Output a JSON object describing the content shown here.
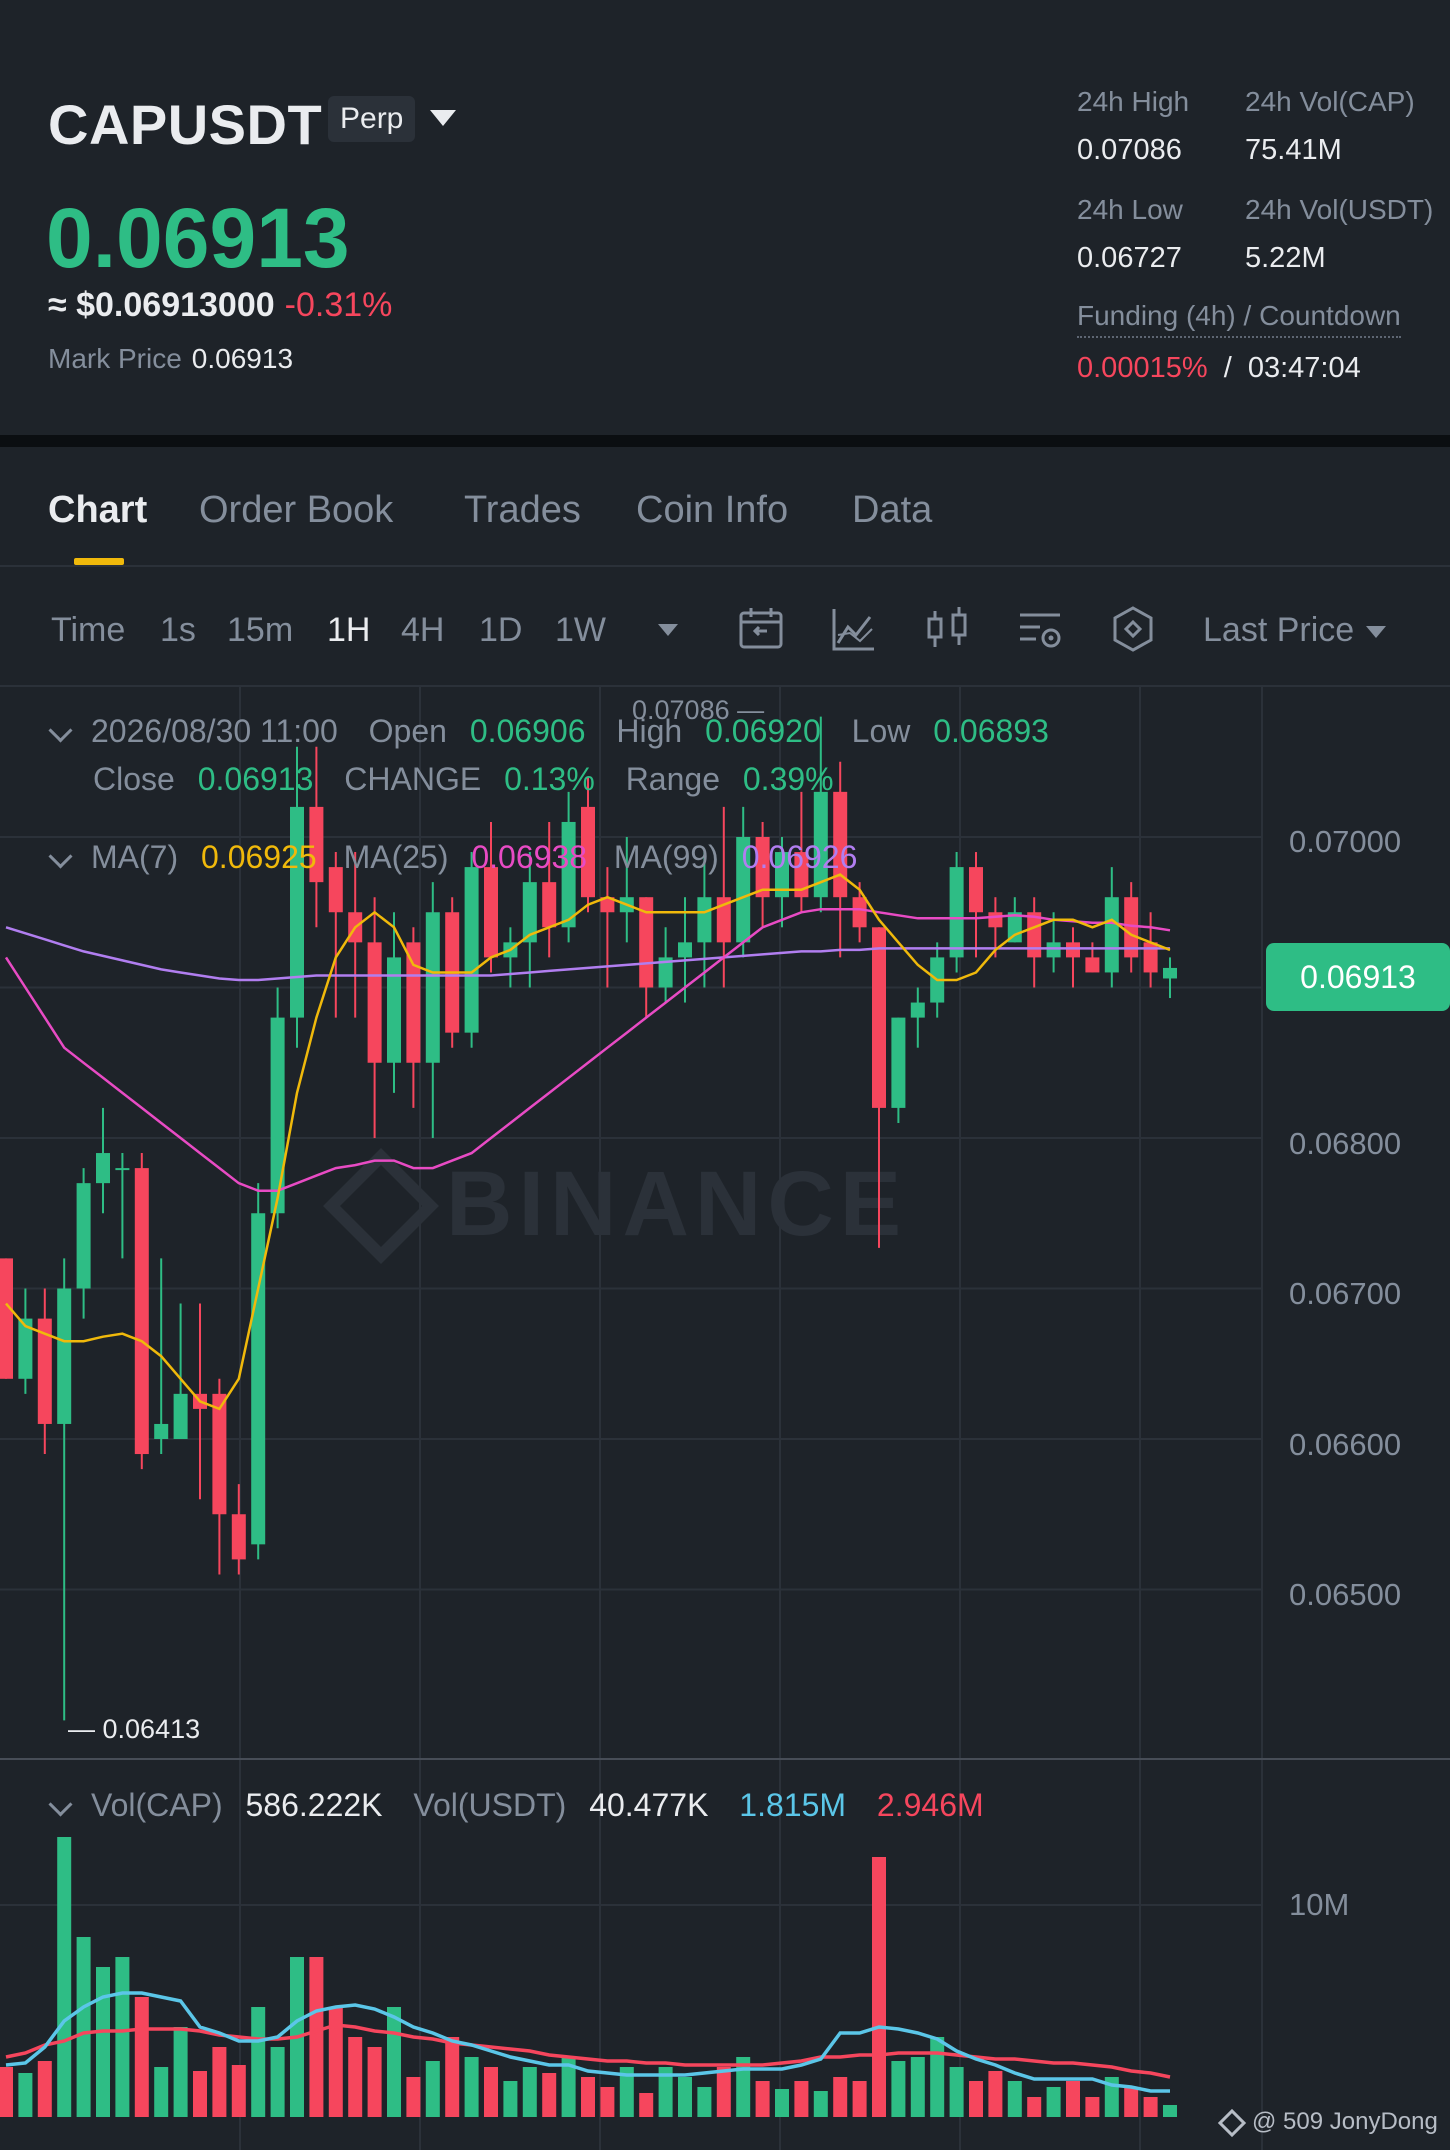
{
  "header": {
    "symbol": "CAPUSDT",
    "badge": "Perp",
    "last_price": "0.06913",
    "usd_price": "≈ $0.06913000",
    "change_pct": "-0.31%",
    "mark_price_label": "Mark Price",
    "mark_price": "0.06913",
    "stats": {
      "high_label": "24h High",
      "high": "0.07086",
      "vol_cap_label": "24h Vol(CAP)",
      "vol_cap": "75.41M",
      "low_label": "24h Low",
      "low": "0.06727",
      "vol_usdt_label": "24h Vol(USDT)",
      "vol_usdt": "5.22M",
      "funding_label": "Funding (4h) / Countdown",
      "funding_rate": "0.00015%",
      "funding_sep": "/",
      "countdown": "03:47:04"
    }
  },
  "tabs": [
    "Chart",
    "Order Book",
    "Trades",
    "Coin Info",
    "Data"
  ],
  "toolbar": {
    "timeframes": [
      "Time",
      "1s",
      "15m",
      "1H",
      "4H",
      "1D",
      "1W"
    ],
    "active_timeframe": "1H",
    "price_type": "Last Price"
  },
  "info": {
    "datetime": "2026/08/30 11:00",
    "open_label": "Open",
    "open": "0.06906",
    "high_label": "High",
    "high": "0.06920",
    "low_label": "Low",
    "low": "0.06893",
    "close_label": "Close",
    "close": "0.06913",
    "change_label": "CHANGE",
    "change": "0.13%",
    "range_label": "Range",
    "range": "0.39%",
    "ma7_label": "MA(7)",
    "ma7": "0.06925",
    "ma25_label": "MA(25)",
    "ma25": "0.06938",
    "ma99_label": "MA(99)",
    "ma99": "0.06926",
    "vol_cap_label": "Vol(CAP)",
    "vol_cap": "586.222K",
    "vol_usdt_label": "Vol(USDT)",
    "vol_usdt": "40.477K",
    "vol_ma1": "1.815M",
    "vol_ma2": "2.946M"
  },
  "axis": {
    "price_ticks": [
      "0.07000",
      "0.06800",
      "0.06700",
      "0.06600",
      "0.06500"
    ],
    "current_price_tag": "0.06913",
    "high_marker": "0.07086",
    "low_marker": "0.06413",
    "volume_tick": "10M"
  },
  "watermark": "BINANCE",
  "credit": "@ 509 JonyDong",
  "colors": {
    "up": "#2ebd85",
    "down": "#f6465d",
    "ma7": "#f0b90b",
    "ma25": "#e84bc4",
    "ma99": "#b17ef0",
    "vol_ma1": "#5bc6e8",
    "vol_ma2": "#f6465d"
  },
  "chart_data": {
    "type": "candlestick",
    "price_range": [
      0.064,
      0.071
    ],
    "candles": [
      {
        "o": 0.0672,
        "h": 0.0672,
        "l": 0.0664,
        "c": 0.0664
      },
      {
        "o": 0.0664,
        "h": 0.067,
        "l": 0.0663,
        "c": 0.0668
      },
      {
        "o": 0.0668,
        "h": 0.067,
        "l": 0.0659,
        "c": 0.0661
      },
      {
        "o": 0.0661,
        "h": 0.0672,
        "l": 0.06413,
        "c": 0.067
      },
      {
        "o": 0.067,
        "h": 0.0678,
        "l": 0.0668,
        "c": 0.0677
      },
      {
        "o": 0.0677,
        "h": 0.0682,
        "l": 0.0675,
        "c": 0.0679
      },
      {
        "o": 0.0678,
        "h": 0.0679,
        "l": 0.0672,
        "c": 0.0678
      },
      {
        "o": 0.0678,
        "h": 0.0679,
        "l": 0.0658,
        "c": 0.0659
      },
      {
        "o": 0.066,
        "h": 0.0672,
        "l": 0.0659,
        "c": 0.0661
      },
      {
        "o": 0.066,
        "h": 0.0669,
        "l": 0.066,
        "c": 0.0663
      },
      {
        "o": 0.0663,
        "h": 0.0669,
        "l": 0.0656,
        "c": 0.0662
      },
      {
        "o": 0.0663,
        "h": 0.0664,
        "l": 0.0651,
        "c": 0.0655
      },
      {
        "o": 0.0655,
        "h": 0.0657,
        "l": 0.0651,
        "c": 0.0652
      },
      {
        "o": 0.0653,
        "h": 0.0677,
        "l": 0.0652,
        "c": 0.0675
      },
      {
        "o": 0.0675,
        "h": 0.069,
        "l": 0.0674,
        "c": 0.0688
      },
      {
        "o": 0.0688,
        "h": 0.0706,
        "l": 0.0686,
        "c": 0.0702
      },
      {
        "o": 0.0702,
        "h": 0.0706,
        "l": 0.0694,
        "c": 0.0697
      },
      {
        "o": 0.0698,
        "h": 0.0699,
        "l": 0.0688,
        "c": 0.0695
      },
      {
        "o": 0.0695,
        "h": 0.0699,
        "l": 0.0688,
        "c": 0.0693
      },
      {
        "o": 0.0693,
        "h": 0.0696,
        "l": 0.068,
        "c": 0.0685
      },
      {
        "o": 0.0685,
        "h": 0.0695,
        "l": 0.0683,
        "c": 0.0692
      },
      {
        "o": 0.0693,
        "h": 0.0694,
        "l": 0.0682,
        "c": 0.0685
      },
      {
        "o": 0.0685,
        "h": 0.0697,
        "l": 0.068,
        "c": 0.0695
      },
      {
        "o": 0.0695,
        "h": 0.0696,
        "l": 0.0686,
        "c": 0.0687
      },
      {
        "o": 0.0687,
        "h": 0.0699,
        "l": 0.0686,
        "c": 0.0698
      },
      {
        "o": 0.0698,
        "h": 0.0701,
        "l": 0.0691,
        "c": 0.0692
      },
      {
        "o": 0.0692,
        "h": 0.0694,
        "l": 0.069,
        "c": 0.0693
      },
      {
        "o": 0.0693,
        "h": 0.0699,
        "l": 0.069,
        "c": 0.0697
      },
      {
        "o": 0.0697,
        "h": 0.0701,
        "l": 0.0692,
        "c": 0.0694
      },
      {
        "o": 0.0694,
        "h": 0.0703,
        "l": 0.0693,
        "c": 0.0701
      },
      {
        "o": 0.0702,
        "h": 0.0704,
        "l": 0.0695,
        "c": 0.0696
      },
      {
        "o": 0.0696,
        "h": 0.0698,
        "l": 0.069,
        "c": 0.0695
      },
      {
        "o": 0.0695,
        "h": 0.07,
        "l": 0.0693,
        "c": 0.0696
      },
      {
        "o": 0.0696,
        "h": 0.0696,
        "l": 0.0688,
        "c": 0.069
      },
      {
        "o": 0.069,
        "h": 0.0694,
        "l": 0.0689,
        "c": 0.0692
      },
      {
        "o": 0.0692,
        "h": 0.0696,
        "l": 0.0689,
        "c": 0.0693
      },
      {
        "o": 0.0693,
        "h": 0.0699,
        "l": 0.069,
        "c": 0.0696
      },
      {
        "o": 0.0696,
        "h": 0.0702,
        "l": 0.069,
        "c": 0.0693
      },
      {
        "o": 0.0693,
        "h": 0.0702,
        "l": 0.0692,
        "c": 0.07
      },
      {
        "o": 0.07,
        "h": 0.0701,
        "l": 0.0694,
        "c": 0.0696
      },
      {
        "o": 0.0696,
        "h": 0.07,
        "l": 0.0694,
        "c": 0.0699
      },
      {
        "o": 0.0699,
        "h": 0.0703,
        "l": 0.0695,
        "c": 0.0696
      },
      {
        "o": 0.0696,
        "h": 0.0708,
        "l": 0.0695,
        "c": 0.0703
      },
      {
        "o": 0.0703,
        "h": 0.0705,
        "l": 0.0692,
        "c": 0.0696
      },
      {
        "o": 0.0696,
        "h": 0.0697,
        "l": 0.0693,
        "c": 0.0694
      },
      {
        "o": 0.0694,
        "h": 0.0694,
        "l": 0.06727,
        "c": 0.0682
      },
      {
        "o": 0.0682,
        "h": 0.0688,
        "l": 0.0681,
        "c": 0.0688
      },
      {
        "o": 0.0688,
        "h": 0.069,
        "l": 0.0686,
        "c": 0.0689
      },
      {
        "o": 0.0689,
        "h": 0.0693,
        "l": 0.0688,
        "c": 0.0692
      },
      {
        "o": 0.0692,
        "h": 0.0699,
        "l": 0.0691,
        "c": 0.0698
      },
      {
        "o": 0.0698,
        "h": 0.0699,
        "l": 0.0692,
        "c": 0.0695
      },
      {
        "o": 0.0695,
        "h": 0.0696,
        "l": 0.0692,
        "c": 0.0694
      },
      {
        "o": 0.0693,
        "h": 0.0696,
        "l": 0.0693,
        "c": 0.0695
      },
      {
        "o": 0.0695,
        "h": 0.0696,
        "l": 0.069,
        "c": 0.0692
      },
      {
        "o": 0.0692,
        "h": 0.0695,
        "l": 0.0691,
        "c": 0.0693
      },
      {
        "o": 0.0693,
        "h": 0.0694,
        "l": 0.069,
        "c": 0.0692
      },
      {
        "o": 0.0692,
        "h": 0.0693,
        "l": 0.0691,
        "c": 0.0691
      },
      {
        "o": 0.0691,
        "h": 0.0698,
        "l": 0.069,
        "c": 0.0696
      },
      {
        "o": 0.0696,
        "h": 0.0697,
        "l": 0.0691,
        "c": 0.0692
      },
      {
        "o": 0.0693,
        "h": 0.0695,
        "l": 0.069,
        "c": 0.0691
      },
      {
        "o": 0.06906,
        "h": 0.0692,
        "l": 0.06893,
        "c": 0.06913
      }
    ],
    "ma7": [
      0.0669,
      0.06675,
      0.0667,
      0.06665,
      0.06665,
      0.06668,
      0.0667,
      0.06665,
      0.06655,
      0.0664,
      0.06625,
      0.0662,
      0.0664,
      0.067,
      0.0676,
      0.0683,
      0.0688,
      0.0692,
      0.0694,
      0.0695,
      0.0694,
      0.06915,
      0.0691,
      0.0691,
      0.0691,
      0.0692,
      0.06925,
      0.06935,
      0.0694,
      0.06945,
      0.06955,
      0.0696,
      0.06955,
      0.0695,
      0.0695,
      0.0695,
      0.0695,
      0.06955,
      0.0696,
      0.06965,
      0.06965,
      0.06965,
      0.0697,
      0.06975,
      0.06965,
      0.06945,
      0.0693,
      0.06915,
      0.06905,
      0.06905,
      0.0691,
      0.06925,
      0.06935,
      0.0694,
      0.06945,
      0.06945,
      0.0694,
      0.06945,
      0.06935,
      0.0693,
      0.06925
    ],
    "ma25": [
      0.0692,
      0.069,
      0.0688,
      0.0686,
      0.0685,
      0.0684,
      0.0683,
      0.0682,
      0.0681,
      0.068,
      0.0679,
      0.0678,
      0.0677,
      0.06765,
      0.06765,
      0.0677,
      0.06775,
      0.0678,
      0.06782,
      0.06785,
      0.06785,
      0.0678,
      0.0678,
      0.06785,
      0.0679,
      0.068,
      0.0681,
      0.0682,
      0.0683,
      0.0684,
      0.0685,
      0.0686,
      0.0687,
      0.0688,
      0.0689,
      0.069,
      0.0691,
      0.0692,
      0.0693,
      0.0694,
      0.06945,
      0.0695,
      0.06952,
      0.06952,
      0.06952,
      0.0695,
      0.06948,
      0.06946,
      0.06946,
      0.06946,
      0.06946,
      0.06947,
      0.06948,
      0.06947,
      0.06945,
      0.06944,
      0.06943,
      0.06943,
      0.06941,
      0.0694,
      0.06938
    ],
    "ma99": [
      0.0694,
      0.06936,
      0.06932,
      0.06928,
      0.06924,
      0.06921,
      0.06918,
      0.06915,
      0.06912,
      0.0691,
      0.06908,
      0.06906,
      0.06905,
      0.06905,
      0.06906,
      0.06907,
      0.06908,
      0.06908,
      0.06908,
      0.06908,
      0.06908,
      0.06908,
      0.06908,
      0.06908,
      0.06908,
      0.06908,
      0.06909,
      0.0691,
      0.06911,
      0.06912,
      0.06913,
      0.06914,
      0.06915,
      0.06916,
      0.06917,
      0.06918,
      0.06919,
      0.0692,
      0.06921,
      0.06922,
      0.06923,
      0.06924,
      0.06924,
      0.06925,
      0.06925,
      0.06926,
      0.06926,
      0.06926,
      0.06926,
      0.06926,
      0.06926,
      0.06926,
      0.06926,
      0.06926,
      0.06926,
      0.06926,
      0.06926,
      0.06926,
      0.06926,
      0.06926,
      0.06926
    ],
    "volume_range": [
      0,
      14000000
    ],
    "volumes": [
      2.5,
      2.2,
      2.8,
      14.0,
      9.0,
      7.5,
      8.0,
      6.0,
      2.5,
      4.5,
      2.3,
      3.5,
      2.6,
      5.5,
      3.5,
      8.0,
      8.0,
      5.5,
      4.0,
      3.5,
      5.5,
      2.0,
      2.8,
      4.0,
      3.0,
      2.5,
      1.8,
      2.5,
      2.2,
      3.0,
      2.0,
      1.5,
      2.5,
      1.2,
      2.5,
      2.0,
      1.5,
      2.5,
      3.0,
      1.8,
      1.4,
      1.8,
      1.3,
      2.0,
      1.8,
      13.0,
      2.8,
      3.0,
      4.0,
      2.5,
      1.8,
      2.3,
      1.8,
      1.0,
      1.5,
      1.8,
      1.0,
      2.0,
      1.5,
      1.0,
      0.6
    ],
    "vol_ma1": [
      2.6,
      2.7,
      3.5,
      4.8,
      5.5,
      6.0,
      6.2,
      6.2,
      6.0,
      5.8,
      4.5,
      4.2,
      3.8,
      3.8,
      4.0,
      4.8,
      5.3,
      5.5,
      5.6,
      5.4,
      5.0,
      4.5,
      4.2,
      3.8,
      3.6,
      3.3,
      3.0,
      2.8,
      2.6,
      2.6,
      2.3,
      2.2,
      2.1,
      2.1,
      2.1,
      2.1,
      2.2,
      2.3,
      2.4,
      2.4,
      2.4,
      2.6,
      2.9,
      4.2,
      4.2,
      4.5,
      4.4,
      4.2,
      3.9,
      3.3,
      2.9,
      2.6,
      2.2,
      1.9,
      1.9,
      1.9,
      1.9,
      1.6,
      1.5,
      1.3,
      1.3
    ],
    "vol_ma2": [
      3.0,
      3.2,
      3.6,
      3.8,
      4.2,
      4.3,
      4.3,
      4.4,
      4.4,
      4.4,
      4.3,
      4.1,
      4.0,
      3.9,
      3.9,
      4.0,
      4.3,
      4.6,
      4.5,
      4.3,
      4.2,
      4.0,
      3.9,
      3.7,
      3.6,
      3.5,
      3.4,
      3.3,
      3.1,
      3.0,
      2.9,
      2.8,
      2.8,
      2.7,
      2.7,
      2.6,
      2.6,
      2.6,
      2.6,
      2.6,
      2.7,
      2.8,
      3.0,
      3.0,
      3.1,
      3.1,
      3.2,
      3.2,
      3.2,
      3.1,
      3.0,
      2.9,
      2.9,
      2.8,
      2.7,
      2.7,
      2.6,
      2.5,
      2.3,
      2.2,
      2.0
    ]
  }
}
